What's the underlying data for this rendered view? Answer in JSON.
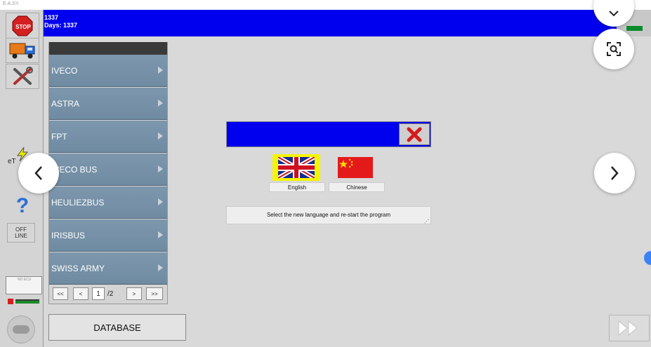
{
  "app": {
    "label": "E.A.SY."
  },
  "header": {
    "line1": "1337",
    "line2": "Days: 1337"
  },
  "toolbar": {
    "stop_label": "STOP",
    "etc_label": "eT",
    "offline_label": "OFF\nLINE",
    "ecu_label": "NO ECU"
  },
  "brands": [
    {
      "label": "IVECO"
    },
    {
      "label": "ASTRA"
    },
    {
      "label": "FPT"
    },
    {
      "label": "IVECO BUS"
    },
    {
      "label": "HEULIEZBUS"
    },
    {
      "label": "IRISBUS"
    },
    {
      "label": "SWISS ARMY"
    }
  ],
  "pager": {
    "first": "<<",
    "prev": "<",
    "page": "1",
    "total": "/2",
    "next": ">",
    "last": ">>"
  },
  "database_label": "DATABASE",
  "dialog": {
    "languages": [
      {
        "label": "English"
      },
      {
        "label": "Chinese"
      }
    ],
    "instruction": "Select the new language and re-start the program"
  },
  "colors": {
    "title_bar": "#0000ee",
    "brand_item": "#7d97ad",
    "status_led": "#0a8a2a",
    "english_highlight": "#f5f500"
  }
}
